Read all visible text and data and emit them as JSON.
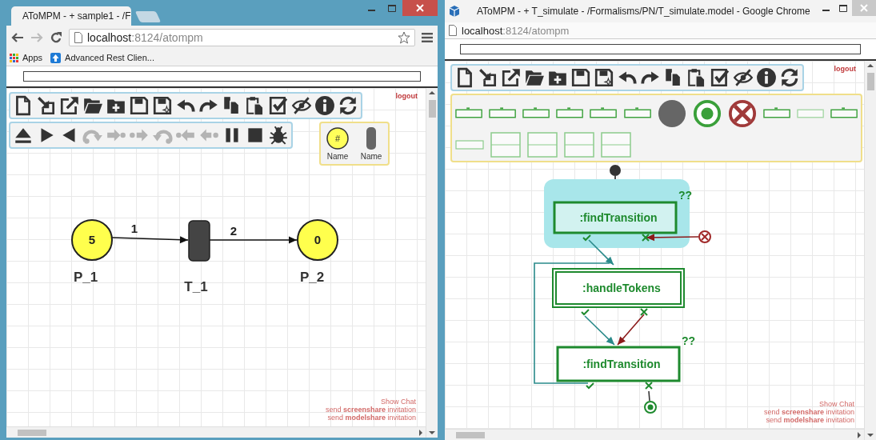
{
  "windows": [
    {
      "kind": "tabbed",
      "tab_title": "AToMPM - + sample1 - /F",
      "nav": {
        "back_disabled": false,
        "forward_disabled": true
      },
      "address": {
        "host": "localhost",
        "path": ":8124/atompm"
      },
      "bookmarks": [
        {
          "kind": "apps",
          "label": "Apps"
        },
        {
          "kind": "arc",
          "label": "Advanced Rest Clien..."
        }
      ],
      "logout": "logout",
      "toolbars": [
        {
          "buttons": [
            {
              "kind": "new",
              "disabled": false
            },
            {
              "kind": "import",
              "disabled": false
            },
            {
              "kind": "export",
              "disabled": false
            },
            {
              "kind": "open",
              "disabled": false
            },
            {
              "kind": "newfolder",
              "disabled": false
            },
            {
              "kind": "save",
              "disabled": false
            },
            {
              "kind": "saveas",
              "disabled": false
            },
            {
              "kind": "undo",
              "disabled": false
            },
            {
              "kind": "redo",
              "disabled": false
            },
            {
              "kind": "copy",
              "disabled": false
            },
            {
              "kind": "paste",
              "disabled": false
            },
            {
              "kind": "validate",
              "disabled": false
            },
            {
              "kind": "hide",
              "disabled": false
            },
            {
              "kind": "info",
              "disabled": false
            },
            {
              "kind": "refresh",
              "disabled": false
            }
          ]
        },
        {
          "buttons": [
            {
              "kind": "eject",
              "disabled": false
            },
            {
              "kind": "play",
              "disabled": false
            },
            {
              "kind": "reverse",
              "disabled": false
            },
            {
              "kind": "stepover",
              "disabled": true
            },
            {
              "kind": "stepin",
              "disabled": true
            },
            {
              "kind": "stepout",
              "disabled": true
            },
            {
              "kind": "stepback",
              "disabled": true
            },
            {
              "kind": "stepbackin",
              "disabled": true
            },
            {
              "kind": "stepbackout",
              "disabled": true
            },
            {
              "kind": "pause",
              "disabled": false
            },
            {
              "kind": "stop",
              "disabled": false
            },
            {
              "kind": "bug",
              "disabled": false
            }
          ]
        }
      ],
      "palette": {
        "rows": [
          {
            "items": [
              {
                "kind": "place",
                "symbol": "#",
                "label": "Name"
              },
              {
                "kind": "transition",
                "label": "Name"
              }
            ]
          }
        ]
      },
      "diagram": {
        "kind": "petri_net",
        "places": [
          {
            "label": "P_1",
            "tokens": "5"
          },
          {
            "label": "P_2",
            "tokens": "0"
          }
        ],
        "transitions": [
          {
            "label": "T_1"
          }
        ],
        "arcs": [
          {
            "label": "1"
          },
          {
            "label": "2"
          }
        ]
      },
      "footer_links": [
        "Show Chat",
        "send **screenshare** invitation",
        "send **modelshare** invitation"
      ]
    },
    {
      "kind": "popup",
      "title": "AToMPM - + T_simulate - /Formalisms/PN/T_simulate.model - Google Chrome",
      "address": {
        "host": "localhost",
        "path": ":8124/atompm"
      },
      "logout": "logout",
      "toolbars": [
        {
          "buttons": [
            {
              "kind": "new",
              "disabled": false
            },
            {
              "kind": "import",
              "disabled": false
            },
            {
              "kind": "export",
              "disabled": false
            },
            {
              "kind": "open",
              "disabled": false
            },
            {
              "kind": "newfolder",
              "disabled": false
            },
            {
              "kind": "save",
              "disabled": false
            },
            {
              "kind": "saveas",
              "disabled": false
            },
            {
              "kind": "undo",
              "disabled": false
            },
            {
              "kind": "redo",
              "disabled": false
            },
            {
              "kind": "copy",
              "disabled": false
            },
            {
              "kind": "paste",
              "disabled": false
            },
            {
              "kind": "validate",
              "disabled": false
            },
            {
              "kind": "hide",
              "disabled": false
            },
            {
              "kind": "info",
              "disabled": false
            },
            {
              "kind": "refresh",
              "disabled": false
            }
          ]
        }
      ],
      "palette": {
        "rows": [
          {
            "items": [
              {
                "kind": "rule"
              },
              {
                "kind": "rule"
              },
              {
                "kind": "rule"
              },
              {
                "kind": "rule"
              },
              {
                "kind": "rule"
              },
              {
                "kind": "rule"
              },
              {
                "kind": "filled_circle"
              },
              {
                "kind": "end_state"
              },
              {
                "kind": "fail_state"
              },
              {
                "kind": "rule"
              },
              {
                "kind": "faded_rule"
              },
              {
                "kind": "rule"
              }
            ]
          },
          {
            "items": [
              {
                "kind": "small_rule"
              },
              {
                "kind": "block"
              },
              {
                "kind": "block"
              },
              {
                "kind": "block"
              },
              {
                "kind": "block"
              }
            ]
          }
        ]
      },
      "diagram": {
        "kind": "schedule",
        "rules": [
          {
            "kind": "rule",
            "label": ":findTransition",
            "highlighted": true,
            "marker": "??"
          },
          {
            "kind": "iterated_rule",
            "label": ":handleTokens",
            "highlighted": false
          },
          {
            "kind": "rule",
            "label": ":findTransition",
            "highlighted": false,
            "marker": "??"
          }
        ]
      },
      "footer_links": [
        "Show Chat",
        "send **screenshare** invitation",
        "send **modelshare** invitation"
      ]
    }
  ]
}
